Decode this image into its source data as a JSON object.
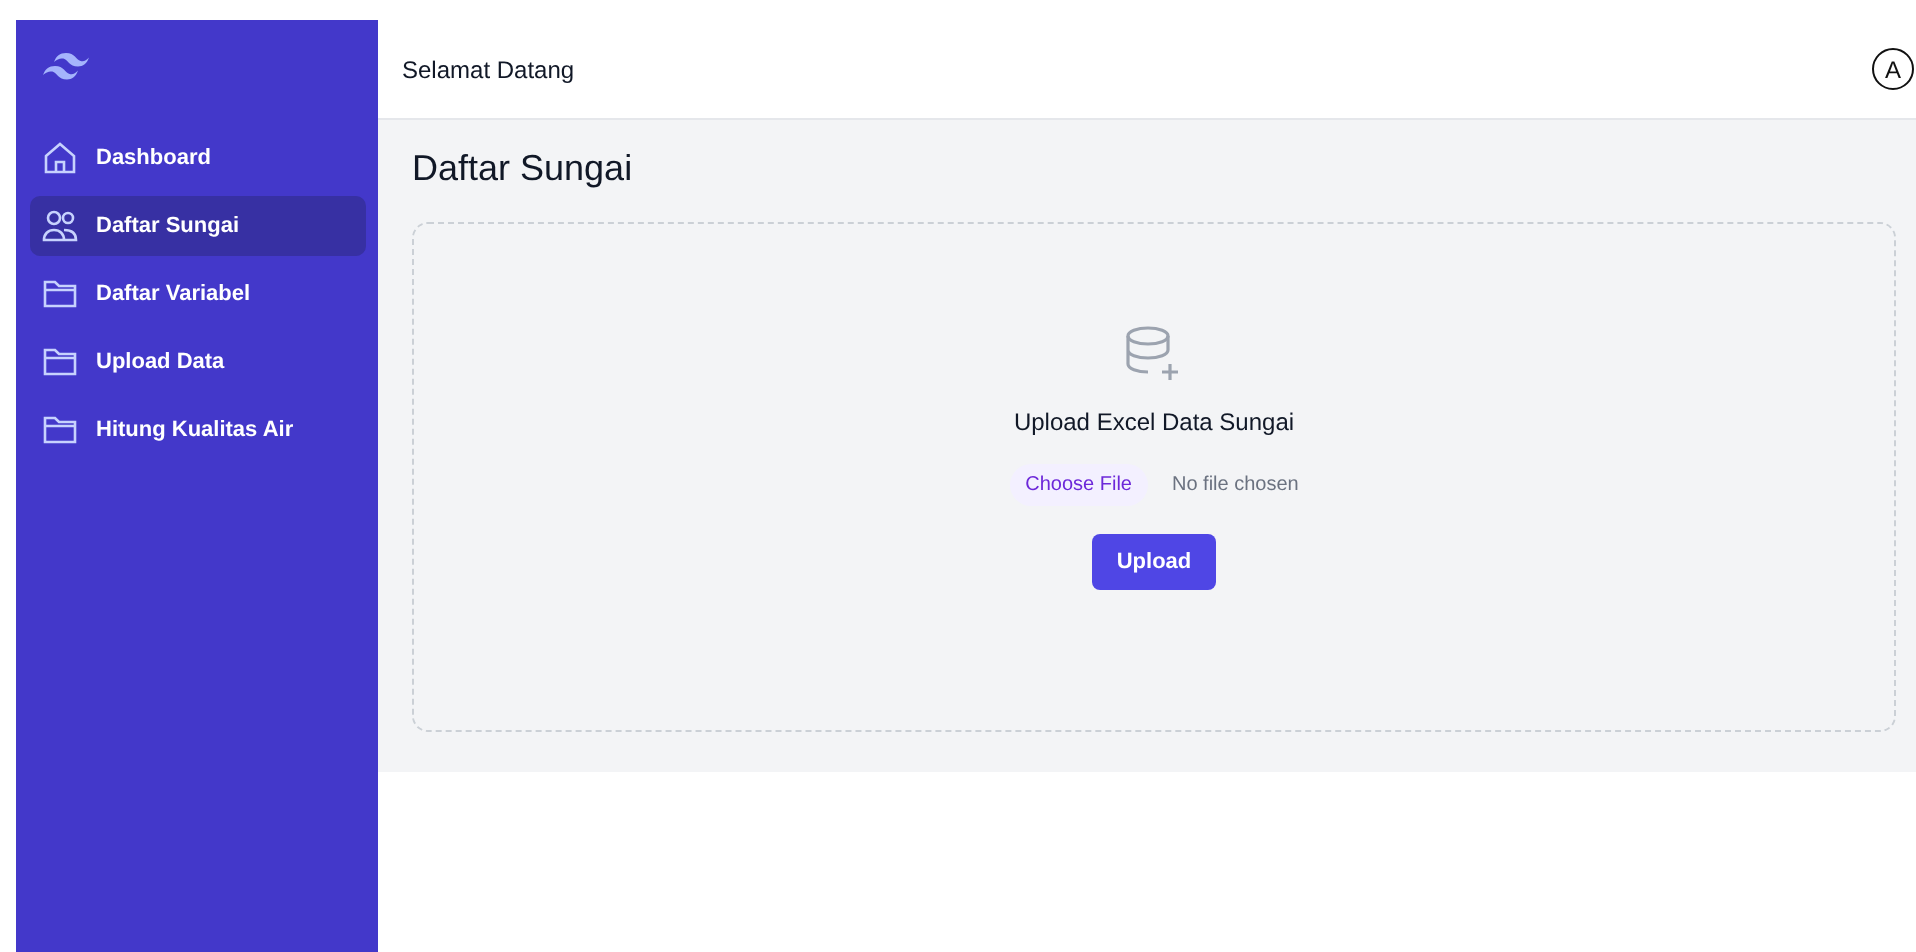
{
  "sidebar": {
    "items": [
      {
        "label": "Dashboard",
        "kind": "home",
        "selected": false
      },
      {
        "label": "Daftar Sungai",
        "kind": "people",
        "selected": true
      },
      {
        "label": "Daftar Variabel",
        "kind": "folder",
        "selected": false
      },
      {
        "label": "Upload Data",
        "kind": "folder",
        "selected": false
      },
      {
        "label": "Hitung Kualitas Air",
        "kind": "folder",
        "selected": false
      }
    ]
  },
  "header": {
    "title": "Selamat Datang",
    "avatar": "A"
  },
  "page": {
    "title": "Daftar Sungai",
    "upload": {
      "heading": "Upload Excel Data Sungai",
      "file_button": "Choose File",
      "file_status": "No file chosen",
      "submit": "Upload"
    }
  }
}
